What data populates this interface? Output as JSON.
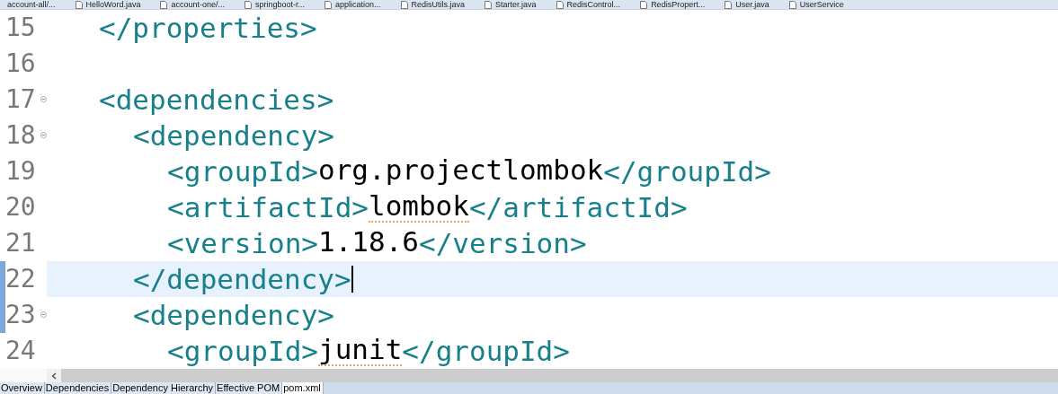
{
  "editor_tabs": [
    {
      "label": "account-all/...",
      "selected": false
    },
    {
      "label": "HelloWord.java",
      "selected": false
    },
    {
      "label": "account-one/...",
      "selected": false
    },
    {
      "label": "springboot-r...",
      "selected": false
    },
    {
      "label": "application...",
      "selected": false
    },
    {
      "label": "RedisUtils.java",
      "selected": false
    },
    {
      "label": "Starter.java",
      "selected": false
    },
    {
      "label": "RedisControl...",
      "selected": false
    },
    {
      "label": "RedisPropert...",
      "selected": false
    },
    {
      "label": "User.java",
      "selected": false
    },
    {
      "label": "UserService",
      "selected": false
    }
  ],
  "lines": [
    {
      "number": "15",
      "foldable": false,
      "current": false,
      "changed": false,
      "tokens": [
        {
          "kind": "tag",
          "text": "</properties>"
        }
      ]
    },
    {
      "number": "16",
      "foldable": false,
      "current": false,
      "changed": false
    },
    {
      "number": "17",
      "foldable": true,
      "current": false,
      "changed": false,
      "tokens": [
        {
          "kind": "tag",
          "text": "<dependencies>"
        }
      ],
      "children": [
        {
          "number": "18",
          "foldable": true,
          "current": false,
          "changed": false,
          "tokens": [
            {
              "kind": "tag",
              "text": "<dependency>"
            }
          ],
          "children": [
            {
              "number": "19",
              "foldable": false,
              "current": false,
              "changed": false,
              "tokens": [
                {
                  "kind": "tag",
                  "text": "<groupId>"
                },
                {
                  "kind": "text",
                  "text": "org.projectlombok",
                  "misspelled": false
                },
                {
                  "kind": "tag",
                  "text": "</groupId>"
                }
              ]
            },
            {
              "number": "20",
              "foldable": false,
              "current": false,
              "changed": false,
              "tokens": [
                {
                  "kind": "tag",
                  "text": "<artifactId>"
                },
                {
                  "kind": "text",
                  "text": "lombok",
                  "misspelled": true
                },
                {
                  "kind": "tag",
                  "text": "</artifactId>"
                }
              ]
            },
            {
              "number": "21",
              "foldable": false,
              "current": false,
              "changed": false,
              "tokens": [
                {
                  "kind": "tag",
                  "text": "<version>"
                },
                {
                  "kind": "text",
                  "text": "1.18.6",
                  "misspelled": false
                },
                {
                  "kind": "tag",
                  "text": "</version>"
                }
              ]
            }
          ]
        },
        {
          "number": "22",
          "foldable": false,
          "current": true,
          "changed": true,
          "tokens": [
            {
              "kind": "tag",
              "text": "</dependency>"
            }
          ]
        },
        {
          "number": "23",
          "foldable": true,
          "current": false,
          "changed": true,
          "tokens": [
            {
              "kind": "tag",
              "text": "<dependency>"
            }
          ],
          "children": [
            {
              "number": "24",
              "foldable": false,
              "current": false,
              "changed": false,
              "tokens": [
                {
                  "kind": "tag",
                  "text": "<groupId>"
                },
                {
                  "kind": "text",
                  "text": "junit",
                  "misspelled": true
                },
                {
                  "kind": "tag",
                  "text": "</groupId>"
                }
              ]
            }
          ]
        }
      ]
    }
  ],
  "bottom_tabs": [
    {
      "label": "Overview",
      "selected": false
    },
    {
      "label": "Dependencies",
      "selected": false
    },
    {
      "label": "Dependency Hierarchy",
      "selected": false
    },
    {
      "label": "Effective POM",
      "selected": false
    },
    {
      "label": "pom.xml",
      "selected": true
    }
  ]
}
